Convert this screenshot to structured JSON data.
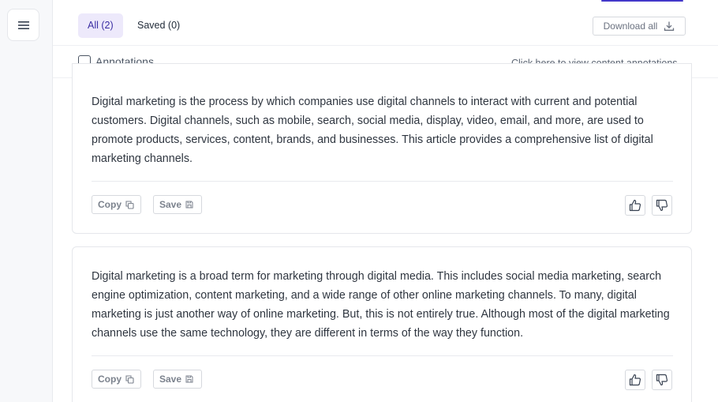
{
  "tabs": {
    "all_label": "All (2)",
    "saved_label": "Saved (0)"
  },
  "toolbar": {
    "download_label": "Download all"
  },
  "annotations": {
    "checkbox_label": "Annotations",
    "checked": false,
    "link_text": "Click here to view content annotations"
  },
  "results": [
    {
      "text": "Digital marketing is the process by which companies use digital channels to interact with current and potential customers. Digital channels, such as mobile, search, social media, display, video, email, and more, are used to promote products, services, content, brands, and businesses. This article provides a comprehensive list of digital marketing channels.",
      "copy_label": "Copy",
      "save_label": "Save"
    },
    {
      "text": "Digital marketing is a broad term for marketing through digital media. This includes social media marketing, search engine optimization, content marketing, and a wide range of other online marketing channels. To many, digital marketing is just another way of online marketing. But, this is not entirely true. Although most of the digital marketing channels use the same technology, they are different in terms of the way they function.",
      "copy_label": "Copy",
      "save_label": "Save"
    }
  ],
  "icons": {
    "menu": "hamburger-menu-icon",
    "download": "download-icon",
    "copy": "copy-icon",
    "save": "floppy-disk-icon",
    "thumbs_up": "thumbs-up-icon",
    "thumbs_down": "thumbs-down-icon"
  },
  "colors": {
    "accent": "#4338ca",
    "active_tab_bg": "#ede9fb",
    "active_tab_text": "#3b2fa3"
  }
}
